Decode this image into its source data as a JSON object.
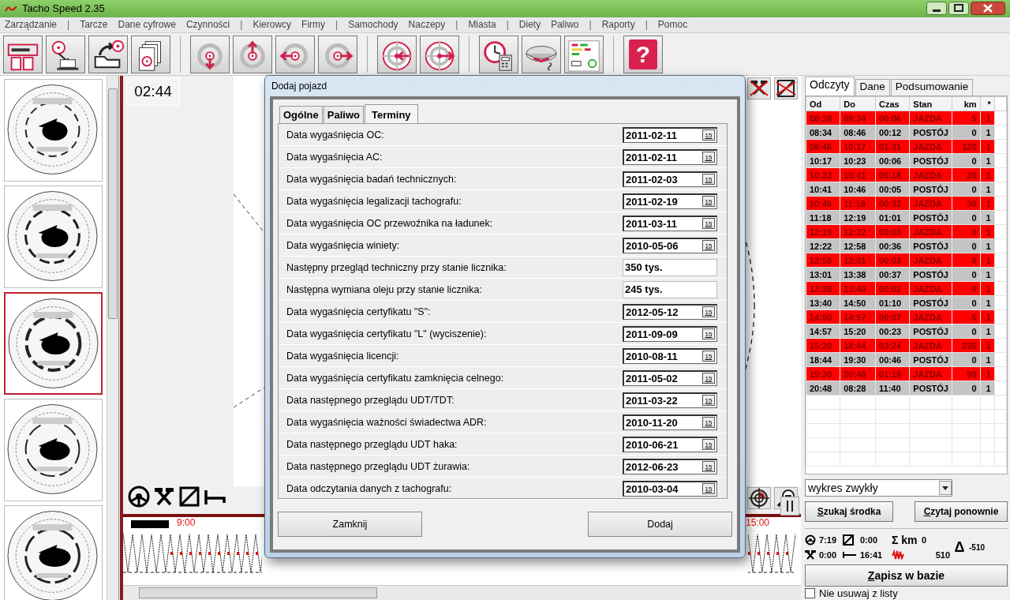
{
  "window": {
    "title": "Tacho Speed 2.35"
  },
  "menu": [
    {
      "label": "Zarządzanie",
      "kind": "item"
    },
    {
      "label": "|",
      "kind": "separator"
    },
    {
      "label": "Tarcze",
      "kind": "item"
    },
    {
      "label": "Dane cyfrowe",
      "kind": "item"
    },
    {
      "label": "Czynności",
      "kind": "item"
    },
    {
      "label": "|",
      "kind": "separator"
    },
    {
      "label": "Kierowcy",
      "kind": "item"
    },
    {
      "label": "Firmy",
      "kind": "item"
    },
    {
      "label": "|",
      "kind": "separator"
    },
    {
      "label": "Samochody",
      "kind": "item"
    },
    {
      "label": "Naczepy",
      "kind": "item"
    },
    {
      "label": "|",
      "kind": "separator"
    },
    {
      "label": "Miasta",
      "kind": "item"
    },
    {
      "label": "|",
      "kind": "separator"
    },
    {
      "label": "Diety",
      "kind": "item"
    },
    {
      "label": "Paliwo",
      "kind": "item"
    },
    {
      "label": "|",
      "kind": "separator"
    },
    {
      "label": "Raporty",
      "kind": "item"
    },
    {
      "label": "|",
      "kind": "separator"
    },
    {
      "label": "Pomoc",
      "kind": "item"
    }
  ],
  "toolbar": {
    "help_label": "?"
  },
  "sidebar": {
    "thumbnails": [
      {
        "kind": "picture",
        "selected": false
      },
      {
        "kind": "picture",
        "selected": false
      },
      {
        "kind": "picture",
        "selected": true
      },
      {
        "kind": "picture",
        "selected": false
      },
      {
        "kind": "picture",
        "selected": false
      }
    ]
  },
  "center": {
    "time": "02:44",
    "timeline": [
      "9:00",
      "15:00"
    ]
  },
  "right_panel": {
    "tabs": [
      {
        "label": "Odczyty",
        "selected": true
      },
      {
        "label": "Dane",
        "selected": false
      },
      {
        "label": "Podsumowanie",
        "selected": false
      }
    ],
    "table": {
      "columns": [
        "Od",
        "Do",
        "Czas",
        "Stan",
        "km",
        "*"
      ],
      "rows": [
        {
          "kind": "jazda",
          "cells": [
            "08:28",
            "08:34",
            "00:06",
            "JAZDA",
            "5",
            "1"
          ]
        },
        {
          "kind": "postoj",
          "cells": [
            "08:34",
            "08:46",
            "00:12",
            "POSTÓJ",
            "0",
            "1"
          ]
        },
        {
          "kind": "jazda",
          "cells": [
            "08:46",
            "10:17",
            "01:31",
            "JAZDA",
            "120",
            "1"
          ]
        },
        {
          "kind": "postoj",
          "cells": [
            "10:17",
            "10:23",
            "00:06",
            "POSTÓJ",
            "0",
            "1"
          ]
        },
        {
          "kind": "jazda",
          "cells": [
            "10:23",
            "10:41",
            "00:18",
            "JAZDA",
            "20",
            "1"
          ]
        },
        {
          "kind": "postoj",
          "cells": [
            "10:41",
            "10:46",
            "00:05",
            "POSTÓJ",
            "0",
            "1"
          ]
        },
        {
          "kind": "jazda",
          "cells": [
            "10:46",
            "11:18",
            "00:32",
            "JAZDA",
            "30",
            "1"
          ]
        },
        {
          "kind": "postoj",
          "cells": [
            "11:18",
            "12:19",
            "01:01",
            "POSTÓJ",
            "0",
            "1"
          ]
        },
        {
          "kind": "jazda",
          "cells": [
            "12:19",
            "12:22",
            "00:03",
            "JAZDA",
            "0",
            "1"
          ]
        },
        {
          "kind": "postoj",
          "cells": [
            "12:22",
            "12:58",
            "00:36",
            "POSTÓJ",
            "0",
            "1"
          ]
        },
        {
          "kind": "jazda",
          "cells": [
            "12:58",
            "13:01",
            "00:03",
            "JAZDA",
            "0",
            "1"
          ]
        },
        {
          "kind": "postoj",
          "cells": [
            "13:01",
            "13:38",
            "00:37",
            "POSTÓJ",
            "0",
            "1"
          ]
        },
        {
          "kind": "jazda",
          "cells": [
            "13:38",
            "13:40",
            "00:02",
            "JAZDA",
            "0",
            "1"
          ]
        },
        {
          "kind": "postoj",
          "cells": [
            "13:40",
            "14:50",
            "01:10",
            "POSTÓJ",
            "0",
            "1"
          ]
        },
        {
          "kind": "jazda",
          "cells": [
            "14:50",
            "14:57",
            "00:07",
            "JAZDA",
            "5",
            "1"
          ]
        },
        {
          "kind": "postoj",
          "cells": [
            "14:57",
            "15:20",
            "00:23",
            "POSTÓJ",
            "0",
            "1"
          ]
        },
        {
          "kind": "jazda",
          "cells": [
            "15:20",
            "18:44",
            "03:24",
            "JAZDA",
            "235",
            "1"
          ]
        },
        {
          "kind": "postoj",
          "cells": [
            "18:44",
            "19:30",
            "00:46",
            "POSTÓJ",
            "0",
            "1"
          ]
        },
        {
          "kind": "jazda",
          "cells": [
            "19:30",
            "20:48",
            "01:18",
            "JAZDA",
            "90",
            "1"
          ]
        },
        {
          "kind": "postoj",
          "cells": [
            "20:48",
            "08:28",
            "11:40",
            "POSTÓJ",
            "0",
            "1"
          ]
        }
      ]
    },
    "chart_type": {
      "value": "wykres zwykły"
    },
    "buttons": [
      "Szukaj środka",
      "Czytaj ponownie"
    ],
    "stats": {
      "driving": "7:19",
      "work": "0:00",
      "availability": "0:00",
      "rest": "16:41",
      "sum_label": "Σ km",
      "sum_km": "0",
      "distance": "510",
      "delta_label": "Δ",
      "delta": "-510"
    },
    "save_button": "Zapisz w bazie",
    "keep_checkbox": {
      "label": "Nie usuwaj z listy",
      "checked": false
    }
  },
  "dialog": {
    "title": "Dodaj pojazd",
    "tabs": [
      {
        "label": "Ogólne",
        "selected": false
      },
      {
        "label": "Paliwo",
        "selected": false
      },
      {
        "label": "Terminy",
        "selected": true
      }
    ],
    "fields": [
      {
        "kind": "date",
        "label": "Data wygaśnięcia OC:",
        "value": "2011-02-11",
        "calendar_label": "15"
      },
      {
        "kind": "date",
        "label": "Data wygaśnięcia AC:",
        "value": "2011-02-11",
        "calendar_label": "15"
      },
      {
        "kind": "date",
        "label": "Data wygaśnięcia badań technicznych:",
        "value": "2011-02-03",
        "calendar_label": "15"
      },
      {
        "kind": "date",
        "label": "Data wygaśnięcia legalizacji tachografu:",
        "value": "2011-02-19",
        "calendar_label": "15"
      },
      {
        "kind": "date",
        "label": "Data wygaśnięcia OC przewoźnika na ładunek:",
        "value": "2011-03-11",
        "calendar_label": "15"
      },
      {
        "kind": "date",
        "label": "Data wygaśnięcia winiety:",
        "value": "2010-05-06",
        "calendar_label": "15"
      },
      {
        "kind": "number",
        "label": "Następny przegląd techniczny przy stanie licznika:",
        "value": "350 tys."
      },
      {
        "kind": "number",
        "label": "Następna wymiana oleju przy stanie licznika:",
        "value": "245 tys."
      },
      {
        "kind": "date",
        "label": "Data wygaśnięcia certyfikatu \"S\":",
        "value": "2012-05-12",
        "calendar_label": "15"
      },
      {
        "kind": "date",
        "label": "Data wygaśnięcia certyfikatu \"L\" (wyciszenie):",
        "value": "2011-09-09",
        "calendar_label": "15"
      },
      {
        "kind": "date",
        "label": "Data wygaśnięcia licencji:",
        "value": "2010-08-11",
        "calendar_label": "15"
      },
      {
        "kind": "date",
        "label": "Data wygaśnięcia certyfikatu zamknięcia celnego:",
        "value": "2011-05-02",
        "calendar_label": "15"
      },
      {
        "kind": "date",
        "label": "Data następnego przeglądu UDT/TDT:",
        "value": "2011-03-22",
        "calendar_label": "15"
      },
      {
        "kind": "date",
        "label": "Data wygaśnięcia ważności świadectwa ADR:",
        "value": "2010-11-20",
        "calendar_label": "15"
      },
      {
        "kind": "date",
        "label": "Data następnego przeglądu UDT haka:",
        "value": "2010-06-21",
        "calendar_label": "15"
      },
      {
        "kind": "date",
        "label": "Data następnego przeglądu UDT żurawia:",
        "value": "2012-06-23",
        "calendar_label": "15"
      },
      {
        "kind": "date",
        "label": "Data odczytania danych z tachografu:",
        "value": "2010-03-04",
        "calendar_label": "15"
      }
    ],
    "buttons": [
      "Zamknij",
      "Dodaj"
    ]
  }
}
